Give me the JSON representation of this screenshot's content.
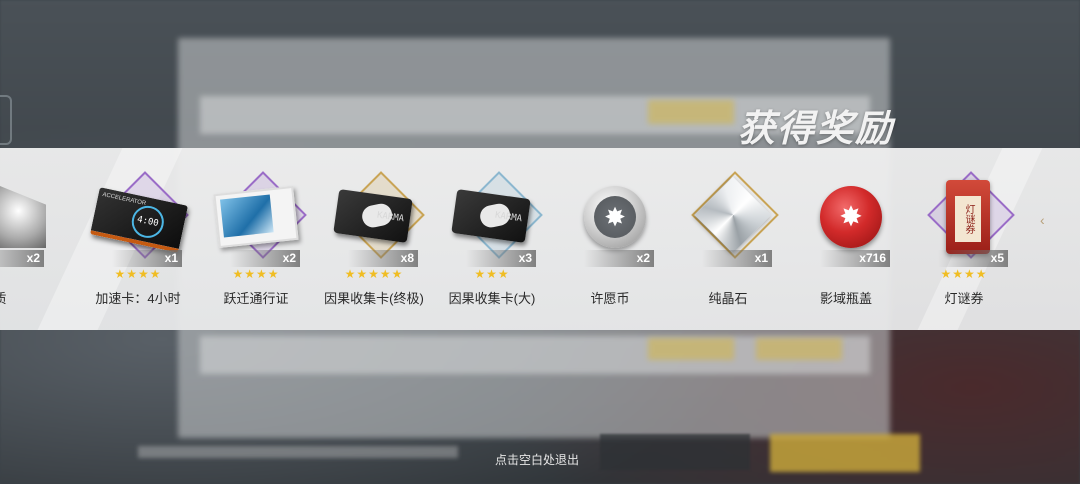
{
  "dialog": {
    "title": "获得奖励",
    "exit_hint": "点击空白处退出"
  },
  "rewards": [
    {
      "name": "质",
      "qty": "x2",
      "stars": "",
      "rarity": "silver"
    },
    {
      "name": "加速卡：4小时",
      "qty": "x1",
      "stars": "★★★★",
      "rarity": "purple",
      "art_text": "4:00",
      "art_brand": "ACCELERATOR"
    },
    {
      "name": "跃迁通行证",
      "qty": "x2",
      "stars": "★★★★",
      "rarity": "purple"
    },
    {
      "name": "因果收集卡(终极)",
      "qty": "x8",
      "stars": "★★★★★",
      "rarity": "gold",
      "art_text": "KARMA"
    },
    {
      "name": "因果收集卡(大)",
      "qty": "x3",
      "stars": "★★★",
      "rarity": "blue",
      "art_text": "KARMA"
    },
    {
      "name": "许愿币",
      "qty": "x2",
      "stars": "",
      "rarity": "silver"
    },
    {
      "name": "纯晶石",
      "qty": "x1",
      "stars": "",
      "rarity": "silver"
    },
    {
      "name": "影域瓶盖",
      "qty": "x716",
      "stars": "",
      "rarity": "silver"
    },
    {
      "name": "灯谜券",
      "qty": "x5",
      "stars": "★★★★",
      "rarity": "purple",
      "art_text": "灯谜券"
    }
  ],
  "icons": {
    "coin_symbol": "✸",
    "cap_symbol": "✸",
    "next_arrow": "‹"
  }
}
